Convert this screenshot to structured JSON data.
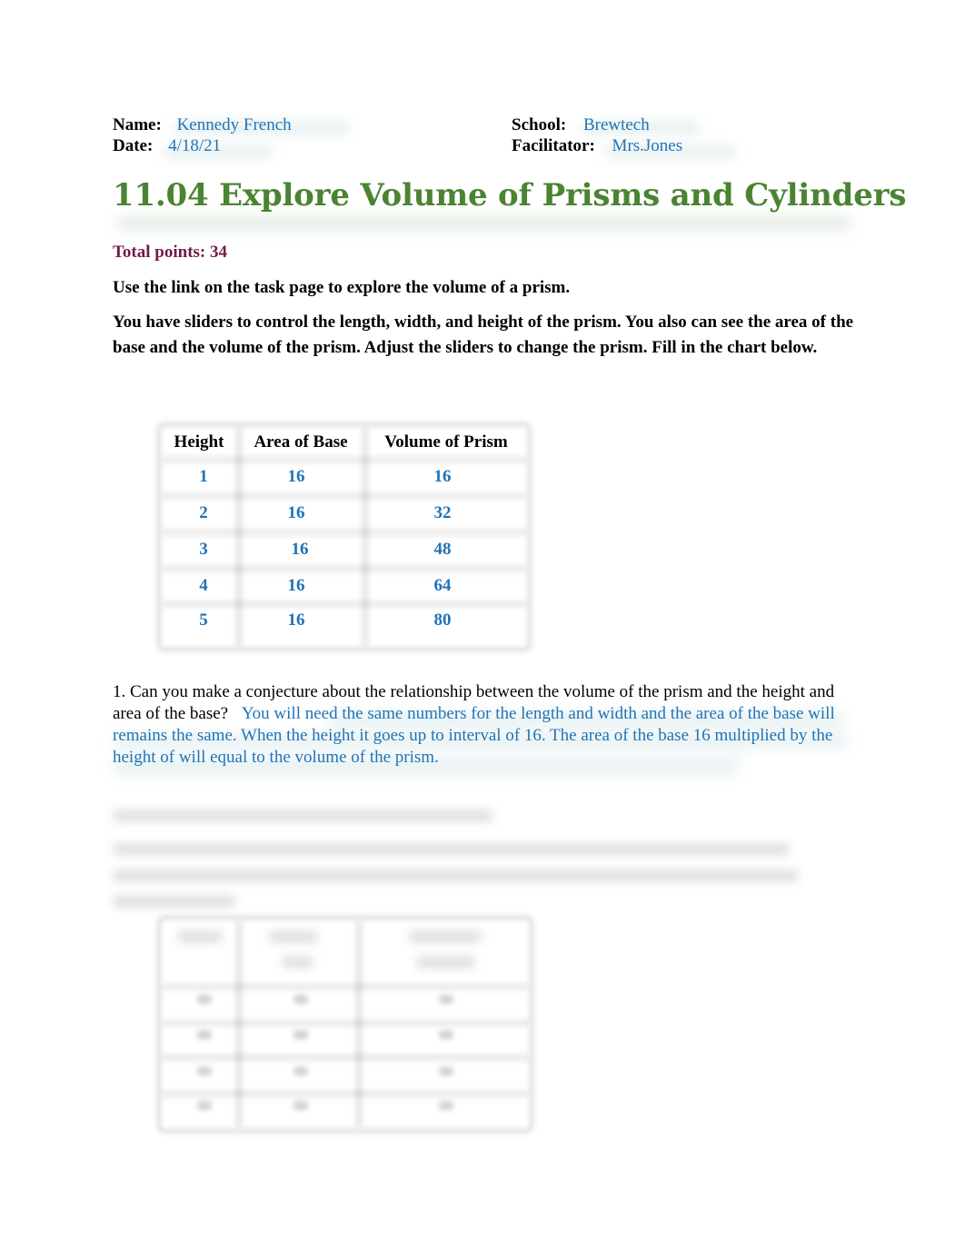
{
  "header": {
    "name_label": "Name:",
    "name_value": "Kennedy French",
    "date_label": "Date:",
    "date_value": "4/18/21",
    "school_label": "School:",
    "school_value": "Brewtech",
    "facilitator_label": "Facilitator:",
    "facilitator_value": "Mrs.Jones"
  },
  "title": "11.04 Explore Volume of Prisms and Cylinders",
  "total_points": "Total points: 34",
  "instructions": {
    "line1": "Use the link on the task page to explore the volume of a prism.",
    "line2": "You have sliders to control the length, width, and height of the prism. You also can see the area of the base and the volume of the prism. Adjust the sliders to change the prism. Fill in the chart below."
  },
  "prism_table": {
    "headers": [
      "Height",
      "Area of Base",
      "Volume of Prism"
    ],
    "rows": [
      [
        "1",
        "16",
        "16"
      ],
      [
        "2",
        "16",
        "32"
      ],
      [
        "3",
        "16",
        "48"
      ],
      [
        "4",
        "16",
        "64"
      ],
      [
        "5",
        "16",
        "80"
      ]
    ]
  },
  "question1": {
    "prompt": "1. Can you make a conjecture about the relationship between the volume of the prism and the height and area of the base?",
    "answer": "You will need the same numbers for the length and width and the area of the base will remains the same. When the height it goes up to interval of 16. The area of the base 16 multiplied by the height of will equal to the volume of the prism."
  },
  "colors": {
    "answer_blue": "#1f73b7",
    "title_green": "#4a8432",
    "points_maroon": "#741b47"
  }
}
